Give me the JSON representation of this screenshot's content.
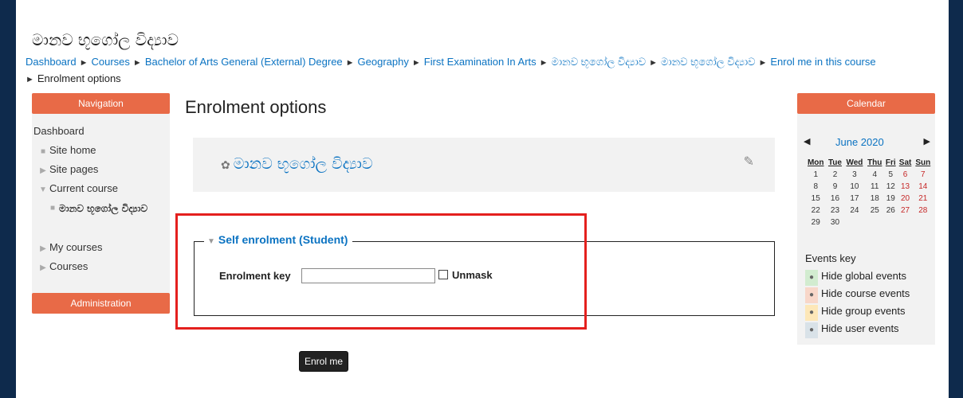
{
  "site": {
    "title": "මානව භූගෝල විද්‍යාව"
  },
  "breadcrumb": [
    "Dashboard",
    "Courses",
    "Bachelor of Arts General (External) Degree",
    "Geography",
    "First Examination In Arts",
    "මානව භූගෝල විද්‍යාව",
    "මානව භූගෝල විද්‍යාව",
    "Enrol me in this course",
    "Enrolment options"
  ],
  "nav": {
    "header": "Navigation",
    "dashboard": "Dashboard",
    "site_home": "Site home",
    "site_pages": "Site pages",
    "current_course": "Current course",
    "course_name": "මානව භූගෝල විද්‍යාව",
    "my_courses": "My courses",
    "courses": "Courses",
    "admin": "Administration"
  },
  "main": {
    "heading": "Enrolment options",
    "course_name": "මානව භූගෝල විද්‍යාව",
    "section_title": "Self enrolment (Student)",
    "key_label": "Enrolment key",
    "key_value": "",
    "unmask_label": "Unmask",
    "enrol_button": "Enrol me"
  },
  "calendar": {
    "header": "Calendar",
    "month": "June 2020",
    "days": [
      "Mon",
      "Tue",
      "Wed",
      "Thu",
      "Fri",
      "Sat",
      "Sun"
    ],
    "weeks": [
      [
        "1",
        "2",
        "3",
        "4",
        "5",
        "6",
        "7"
      ],
      [
        "8",
        "9",
        "10",
        "11",
        "12",
        "13",
        "14"
      ],
      [
        "15",
        "16",
        "17",
        "18",
        "19",
        "20",
        "21"
      ],
      [
        "22",
        "23",
        "24",
        "25",
        "26",
        "27",
        "28"
      ],
      [
        "29",
        "30",
        "",
        "",
        "",
        "",
        ""
      ]
    ],
    "events_key_title": "Events key",
    "events": [
      {
        "label": "Hide global events",
        "color": "#d2ecd0"
      },
      {
        "label": "Hide course events",
        "color": "#f8d7c9"
      },
      {
        "label": "Hide group events",
        "color": "#fde7b8"
      },
      {
        "label": "Hide user events",
        "color": "#d9e2e8"
      }
    ]
  },
  "colors": {
    "accent": "#e86a47",
    "link": "#0b73c2",
    "highlight": "#e4201e",
    "frame": "#0e2a4c"
  }
}
